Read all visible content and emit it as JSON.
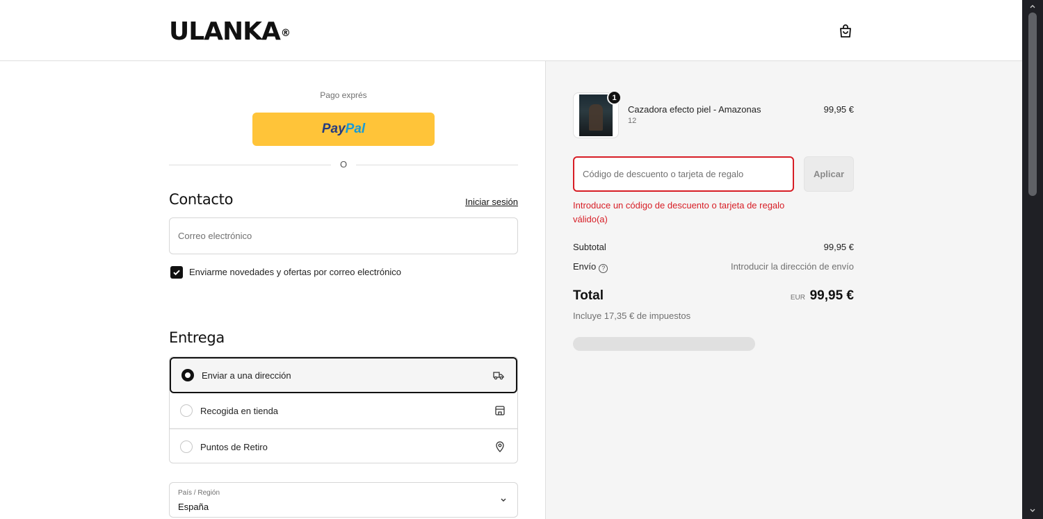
{
  "header": {
    "logo": "ULANKA",
    "logo_mark": "®",
    "cart_icon": "shopping-bag-icon"
  },
  "express": {
    "label": "Pago exprés",
    "paypal_part1": "Pay",
    "paypal_part2": "Pal",
    "divider_text": "O"
  },
  "contact": {
    "title": "Contacto",
    "login_link": "Iniciar sesión",
    "email_placeholder": "Correo electrónico",
    "newsletter_label": "Enviarme novedades y ofertas por correo electrónico",
    "newsletter_checked": true
  },
  "delivery": {
    "title": "Entrega",
    "options": [
      {
        "label": "Enviar a una dirección",
        "selected": true,
        "icon": "truck-icon"
      },
      {
        "label": "Recogida en tienda",
        "selected": false,
        "icon": "store-icon"
      },
      {
        "label": "Puntos de Retiro",
        "selected": false,
        "icon": "location-pin-icon"
      }
    ],
    "country_label": "País / Región",
    "country_value": "España"
  },
  "summary": {
    "product": {
      "name": "Cazadora efecto piel - Amazonas",
      "variant": "12",
      "price": "99,95 €",
      "quantity": "1"
    },
    "discount_placeholder": "Código de descuento o tarjeta de regalo",
    "apply_label": "Aplicar",
    "error": "Introduce un código de descuento o tarjeta de regalo válido(a)",
    "subtotal_label": "Subtotal",
    "subtotal_value": "99,95 €",
    "shipping_label": "Envío",
    "shipping_value": "Introducir la dirección de envío",
    "help_glyph": "?",
    "total_label": "Total",
    "total_currency": "EUR",
    "total_value": "99,95 €",
    "taxes": "Incluye 17,35 € de impuestos"
  },
  "colors": {
    "error": "#d71d25",
    "paypal": "#ffc439",
    "summary_bg": "#f5f5f5"
  }
}
